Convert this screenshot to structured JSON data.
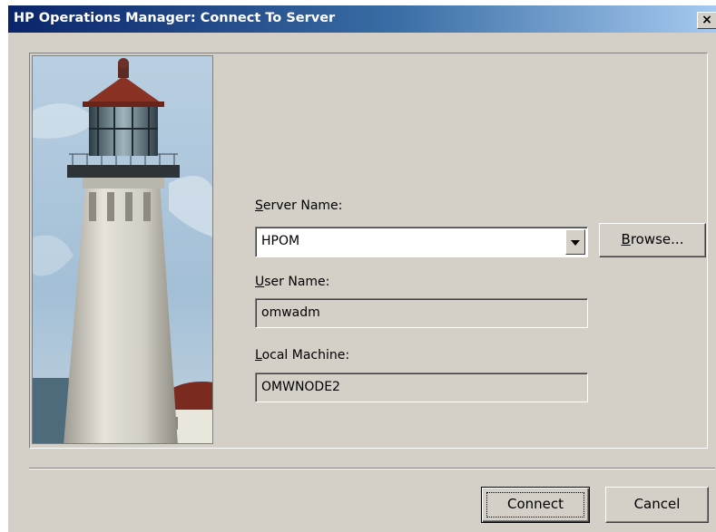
{
  "window": {
    "title": "HP Operations Manager: Connect To Server",
    "close_glyph": "×"
  },
  "image": {
    "icon": "lighthouse-image",
    "colors": {
      "sky": "#9dbbd4",
      "tower": "#d9d6cc",
      "roof": "#8a3324",
      "sea": "#4a6a7c"
    }
  },
  "form": {
    "server_name": {
      "label_accel": "S",
      "label_rest": "erver Name:",
      "value": "HPOM"
    },
    "browse_button": {
      "label_accel": "B",
      "label_rest": "rowse..."
    },
    "user_name": {
      "label_accel": "U",
      "label_rest": "ser Name:",
      "value": "omwadm"
    },
    "local_machine": {
      "label_accel": "L",
      "label_rest": "ocal Machine:",
      "value": "OMWNODE2"
    }
  },
  "buttons": {
    "connect": "Connect",
    "cancel": "Cancel"
  },
  "colors": {
    "dialog_bg": "#d4d0c8",
    "title_gradient_start": "#0a246a",
    "title_gradient_end": "#a6caf0"
  }
}
